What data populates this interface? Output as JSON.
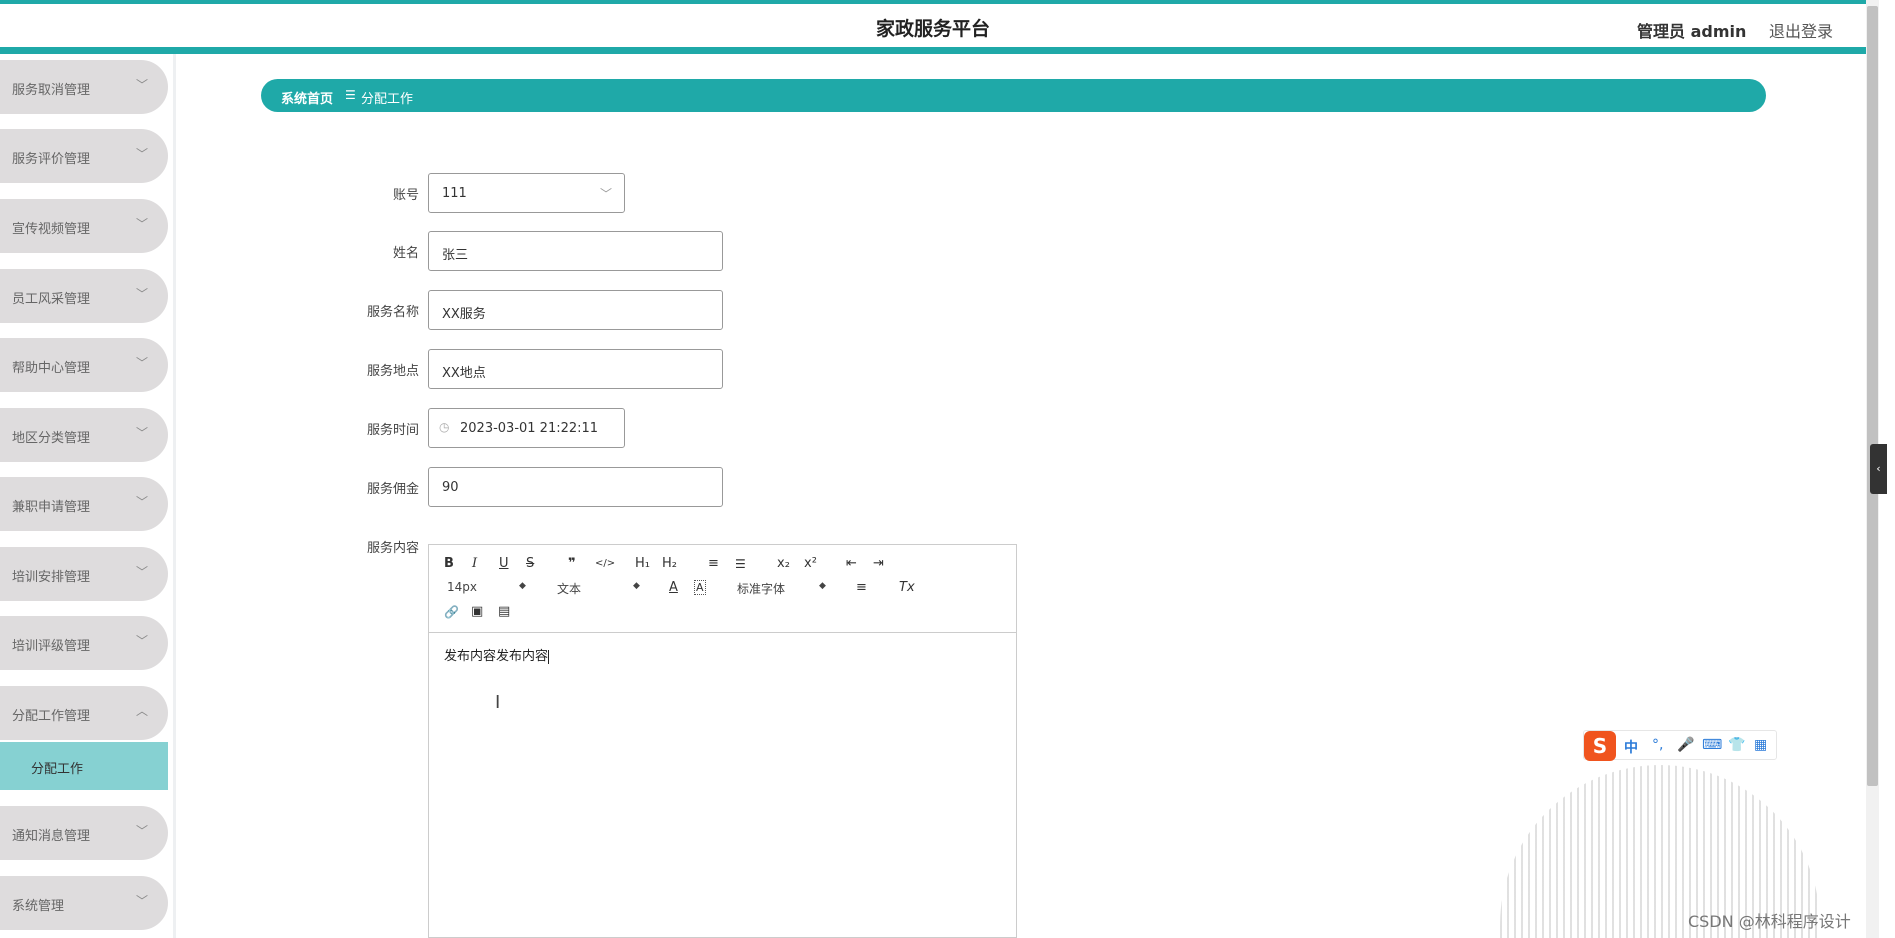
{
  "header": {
    "title": "家政服务平台",
    "admin_label": "管理员 admin",
    "logout_label": "退出登录"
  },
  "sidebar": {
    "items": [
      {
        "label": "服务取消管理",
        "chevron": "﹀"
      },
      {
        "label": "服务评价管理",
        "chevron": "﹀"
      },
      {
        "label": "宣传视频管理",
        "chevron": "﹀"
      },
      {
        "label": "员工风采管理",
        "chevron": "﹀"
      },
      {
        "label": "帮助中心管理",
        "chevron": "﹀"
      },
      {
        "label": "地区分类管理",
        "chevron": "﹀"
      },
      {
        "label": "兼职申请管理",
        "chevron": "﹀"
      },
      {
        "label": "培训安排管理",
        "chevron": "﹀"
      },
      {
        "label": "培训评级管理",
        "chevron": "﹀"
      },
      {
        "label": "分配工作管理",
        "chevron": "︿"
      },
      {
        "label": "通知消息管理",
        "chevron": "﹀"
      },
      {
        "label": "系统管理",
        "chevron": "﹀"
      }
    ],
    "active_subitem": "分配工作"
  },
  "breadcrumb": {
    "home": "系统首页",
    "separator": "☰",
    "current": "分配工作"
  },
  "form": {
    "account": {
      "label": "账号",
      "value": "111"
    },
    "name": {
      "label": "姓名",
      "value": "张三"
    },
    "service_name": {
      "label": "服务名称",
      "value": "XX服务"
    },
    "service_location": {
      "label": "服务地点",
      "value": "XX地点"
    },
    "service_time": {
      "label": "服务时间",
      "value": "2023-03-01 21:22:11"
    },
    "service_fee": {
      "label": "服务佣金",
      "value": "90"
    },
    "service_content": {
      "label": "服务内容",
      "value": "发布内容发布内容"
    }
  },
  "editor": {
    "font_size": "14px",
    "paragraph": "文本",
    "font_family": "标准字体",
    "buttons": {
      "bold": "B",
      "italic": "I",
      "underline": "U",
      "strike": "S",
      "blockquote": "❞",
      "code": "</>",
      "h1": "H₁",
      "h2": "H₂",
      "ordered_list": "≡",
      "bullet_list": "☰",
      "subscript": "x₂",
      "superscript": "x²",
      "outdent": "⇤",
      "indent": "⇥",
      "font_color": "A",
      "background": "A",
      "align": "≡",
      "clean": "Tx",
      "link": "🔗",
      "image": "▣",
      "video": "▤"
    }
  },
  "ime": {
    "logo": "S",
    "items": [
      "中",
      "°,",
      "🎤",
      "⌨",
      "👕",
      "▦"
    ]
  },
  "watermark": "CSDN @林科程序设计",
  "colors": {
    "accent": "#1fa9a8",
    "sidebar_item": "#dedcdd",
    "sidebar_active": "#86d1d2"
  }
}
